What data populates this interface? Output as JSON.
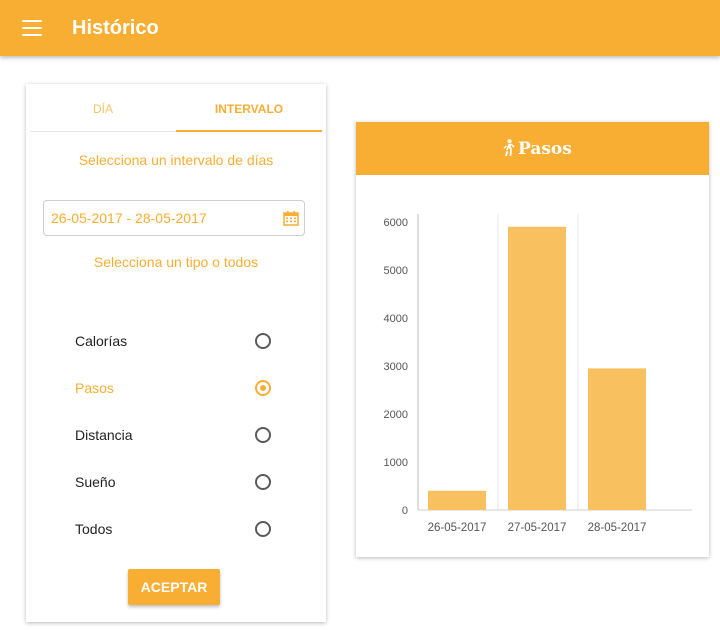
{
  "app": {
    "title": "Histórico"
  },
  "tabs": [
    {
      "label": "DÍA",
      "active": false
    },
    {
      "label": "INTERVALO",
      "active": true
    }
  ],
  "form": {
    "interval_label": "Selecciona un intervalo de días",
    "date_range": "26-05-2017 - 28-05-2017",
    "type_label": "Selecciona un tipo o todos",
    "options": [
      {
        "label": "Calorías",
        "selected": false
      },
      {
        "label": "Pasos",
        "selected": true
      },
      {
        "label": "Distancia",
        "selected": false
      },
      {
        "label": "Sueño",
        "selected": false
      },
      {
        "label": "Todos",
        "selected": false
      }
    ],
    "accept_label": "ACEPTAR"
  },
  "chart_card": {
    "title": "Pasos",
    "icon": "walking-icon"
  },
  "colors": {
    "accent": "#f8ae33",
    "bar": "#f8c05e"
  },
  "chart_data": {
    "type": "bar",
    "title": "Pasos",
    "categories": [
      "26-05-2017",
      "27-05-2017",
      "28-05-2017"
    ],
    "values": [
      400,
      5900,
      2950
    ],
    "yticks": [
      0,
      1000,
      2000,
      3000,
      4000,
      5000,
      6000
    ],
    "ylim": [
      0,
      6200
    ],
    "xlabel": "",
    "ylabel": "",
    "grid": true,
    "legend": "none"
  }
}
